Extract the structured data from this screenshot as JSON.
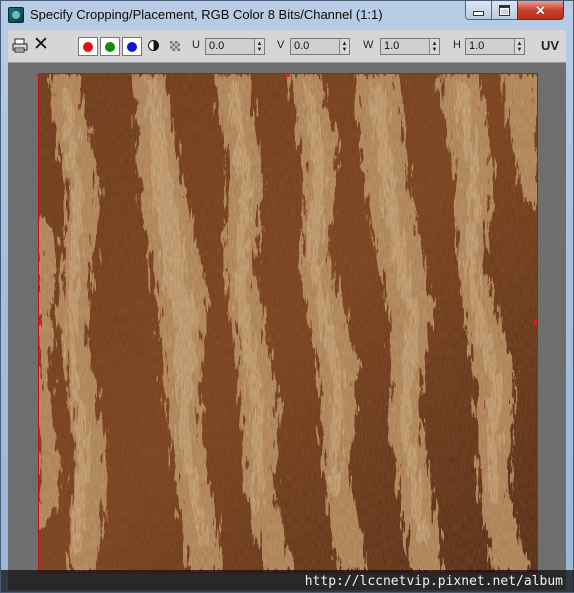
{
  "window": {
    "title": "Specify Cropping/Placement, RGB Color 8 Bits/Channel (1:1)",
    "icon": "3dsmax-app-icon"
  },
  "toolbar": {
    "save_icon": "save-printer-icon",
    "clear_icon": "close-x-icon",
    "channels": [
      {
        "name": "red",
        "color": "#e01010"
      },
      {
        "name": "green",
        "color": "#108a10"
      },
      {
        "name": "blue",
        "color": "#1414d0"
      }
    ],
    "fields": [
      {
        "label": "U",
        "value": "0.0"
      },
      {
        "label": "V",
        "value": "0.0"
      },
      {
        "label": "W",
        "value": "1.0"
      },
      {
        "label": "H",
        "value": "1.0"
      }
    ],
    "uv_label": "UV"
  },
  "image": {
    "subject": "tree bark texture",
    "border_color": "#c01414"
  },
  "watermark": "http://lccnetvip.pixnet.net/album"
}
